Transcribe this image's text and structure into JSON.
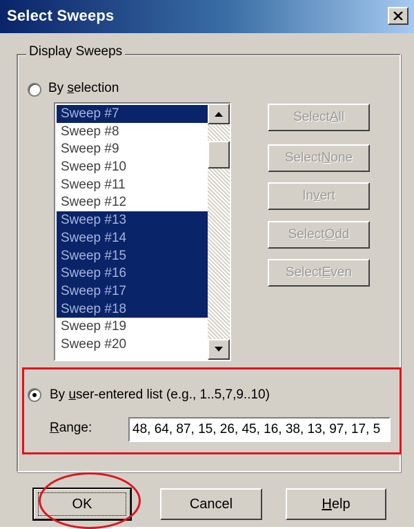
{
  "window": {
    "title": "Select Sweeps",
    "close_icon": "close-icon"
  },
  "display_sweeps": {
    "legend": "Display Sweeps",
    "by_selection": {
      "label_pre": "By ",
      "label_mnemonic": "s",
      "label_post": "election",
      "checked": false
    },
    "list": {
      "items": [
        {
          "label": "Sweep #7",
          "selected": true
        },
        {
          "label": "Sweep #8",
          "selected": false
        },
        {
          "label": "Sweep #9",
          "selected": false
        },
        {
          "label": "Sweep #10",
          "selected": false
        },
        {
          "label": "Sweep #11",
          "selected": false
        },
        {
          "label": "Sweep #12",
          "selected": false
        },
        {
          "label": "Sweep #13",
          "selected": true
        },
        {
          "label": "Sweep #14",
          "selected": true
        },
        {
          "label": "Sweep #15",
          "selected": true
        },
        {
          "label": "Sweep #16",
          "selected": true
        },
        {
          "label": "Sweep #17",
          "selected": true
        },
        {
          "label": "Sweep #18",
          "selected": true
        },
        {
          "label": "Sweep #19",
          "selected": false
        },
        {
          "label": "Sweep #20",
          "selected": false
        }
      ]
    },
    "buttons": {
      "select_all": {
        "pre": "Select ",
        "mn": "A",
        "post": "ll"
      },
      "select_none": {
        "pre": "Select ",
        "mn": "N",
        "post": "one"
      },
      "invert": {
        "pre": "In",
        "mn": "v",
        "post": "ert"
      },
      "select_odd": {
        "pre": "Select ",
        "mn": "O",
        "post": "dd"
      },
      "select_even": {
        "pre": "Select ",
        "mn": "E",
        "post": "ven"
      }
    },
    "by_list": {
      "label_pre": "By ",
      "label_mnemonic": "u",
      "label_post": "ser-entered list  (e.g., 1..5,7,9..10)",
      "checked": true
    },
    "range": {
      "label_mnemonic": "R",
      "label_post": "ange:",
      "value": "48, 64, 87, 15, 26, 45, 16, 38, 13, 97, 17, 5"
    }
  },
  "footer": {
    "ok": "OK",
    "cancel": "Cancel",
    "help_mnemonic": "H",
    "help_post": "elp"
  },
  "colors": {
    "selection": "#0a246a",
    "annotation": "#e0141e",
    "dialog_bg": "#d4d0c8"
  }
}
